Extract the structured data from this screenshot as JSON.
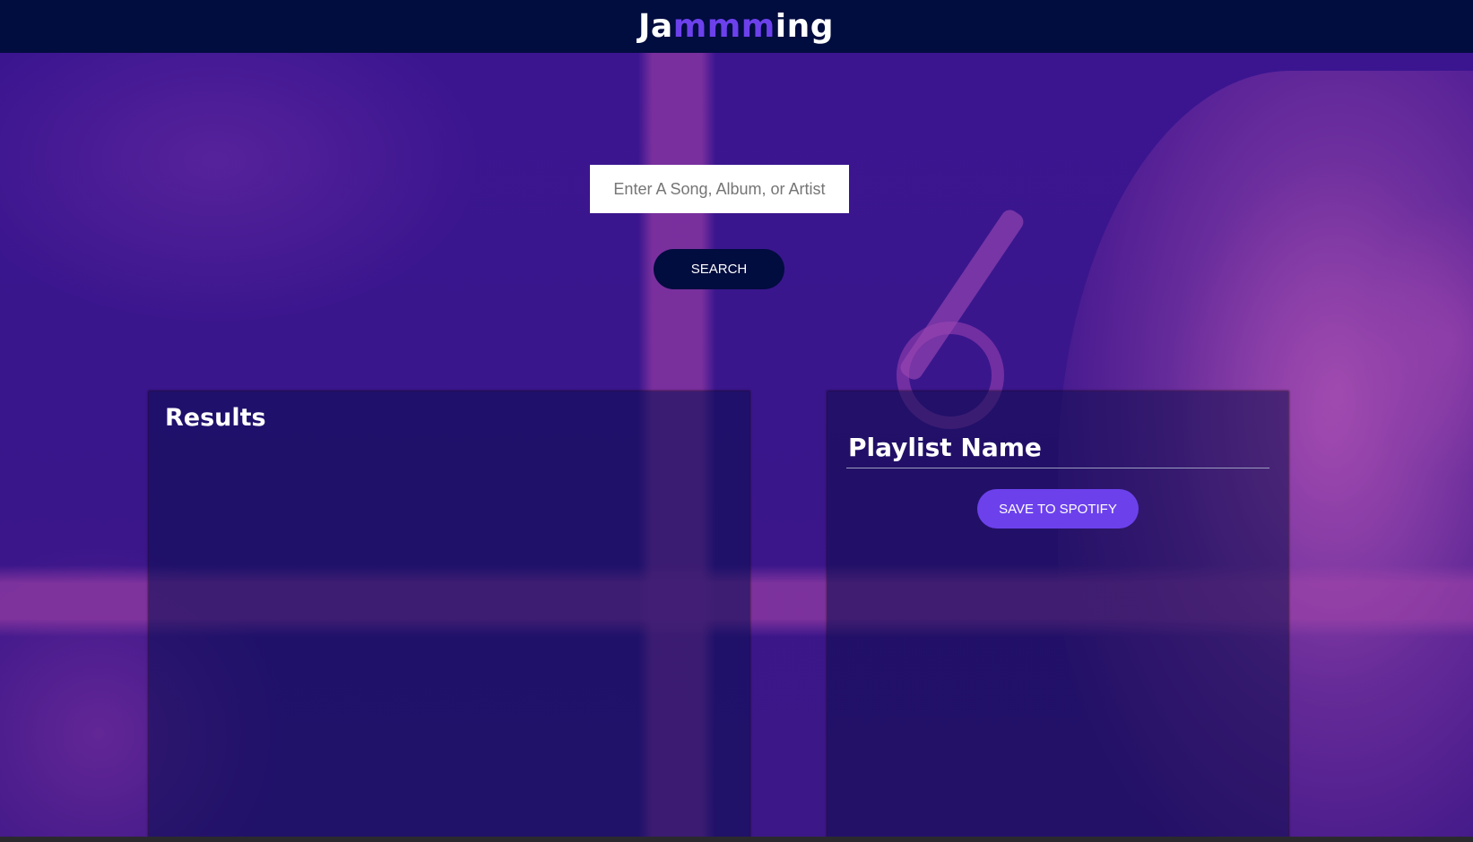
{
  "header": {
    "logo_prefix": "Ja",
    "logo_accent": "mmm",
    "logo_suffix": "ing"
  },
  "search": {
    "placeholder": "Enter A Song, Album, or Artist",
    "value": "",
    "button_label": "SEARCH"
  },
  "results": {
    "title": "Results",
    "tracks": []
  },
  "playlist": {
    "name_placeholder": "Playlist Name",
    "name_value": "",
    "save_label": "SAVE TO SPOTIFY",
    "tracks": []
  },
  "colors": {
    "header_bg": "#010c3f",
    "accent": "#6c41ec",
    "search_button_bg": "#010c3f",
    "panel_bg": "#0a0c50"
  }
}
